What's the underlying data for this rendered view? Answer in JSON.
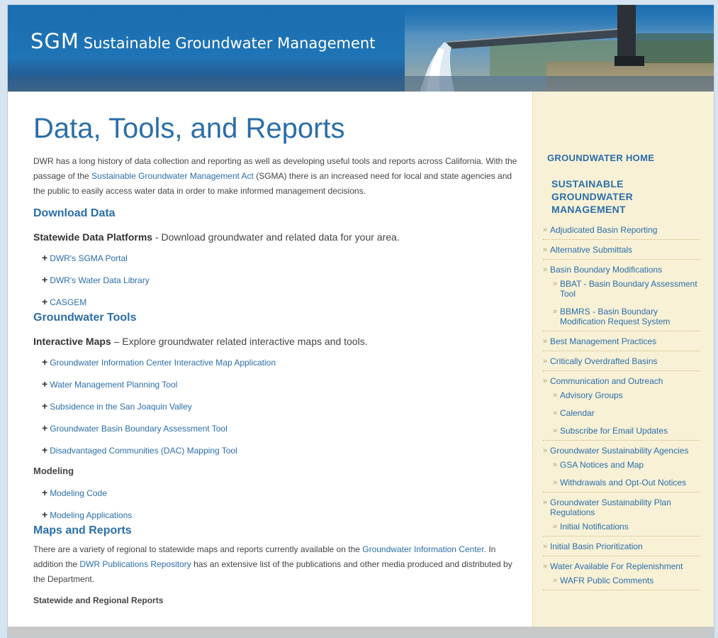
{
  "banner": {
    "abbr": "SGM",
    "full": "Sustainable Groundwater Management"
  },
  "main": {
    "title": "Data, Tools, and Reports",
    "intro": {
      "part1": "DWR has a long history of data collection and reporting as well as developing useful tools and reports across California. With the passage of the ",
      "link": "Sustainable Groundwater Management Act",
      "part2": " (SGMA) there is an increased need for local and state agencies and the public to easily access water data in order to make informed management decisions."
    },
    "download": {
      "heading": "Download Data",
      "platforms_bold": "Statewide Data Platforms",
      "platforms_rest": " - Download groundwater and related data for your area.",
      "items": [
        "DWR's SGMA Portal",
        "DWR's Water Data Library",
        "CASGEM"
      ]
    },
    "tools": {
      "heading": "Groundwater Tools",
      "maps_bold": "Interactive Maps",
      "maps_rest": " – Explore groundwater related interactive maps and tools.",
      "items": [
        "Groundwater Information Center Interactive Map Application",
        "Water Management Planning Tool",
        "Subsidence in the San Joaquin Valley",
        "Groundwater Basin Boundary Assessment Tool",
        "Disadvantaged Communities (DAC) Mapping Tool"
      ],
      "modeling_heading": "Modeling",
      "modeling_items": [
        "Modeling Code",
        "Modeling Applications"
      ]
    },
    "reports": {
      "heading": "Maps and Reports",
      "part1": "There are a variety of regional to statewide maps and reports currently available on the ",
      "link1": "Groundwater Information Center",
      "part2": ". In addition the ",
      "link2": "DWR Publications Repository",
      "part3": " has an extensive list of the publications and other media produced and distributed by the Department.",
      "subheading": "Statewide and Regional Reports"
    }
  },
  "sidebar": {
    "home": "GROUNDWATER HOME",
    "title": "SUSTAINABLE GROUNDWATER MANAGEMENT",
    "items": [
      {
        "label": "Adjudicated Basin Reporting",
        "subs": []
      },
      {
        "label": "Alternative Submittals",
        "subs": []
      },
      {
        "label": "Basin Boundary Modifications",
        "subs": [
          "BBAT - Basin Boundary Assessment Tool",
          "BBMRS - Basin Boundary Modification Request System"
        ]
      },
      {
        "label": "Best Management Practices",
        "subs": []
      },
      {
        "label": "Critically Overdrafted Basins",
        "subs": []
      },
      {
        "label": "Communication and Outreach",
        "subs": [
          "Advisory Groups",
          "Calendar",
          "Subscribe for Email Updates"
        ]
      },
      {
        "label": "Groundwater Sustainability Agencies",
        "subs": [
          "GSA Notices and Map",
          "Withdrawals and Opt-Out Notices"
        ]
      },
      {
        "label": "Groundwater Sustainability Plan Regulations",
        "subs": [
          "Initial Notifications"
        ]
      },
      {
        "label": "Initial Basin Prioritization",
        "subs": []
      },
      {
        "label": "Water Available For Replenishment",
        "subs": [
          "WAFR Public Comments"
        ]
      }
    ]
  },
  "colors": {
    "link": "#2b6ea8",
    "banner": "#1f74b6",
    "sidebar_bg": "#f8f1d6"
  }
}
